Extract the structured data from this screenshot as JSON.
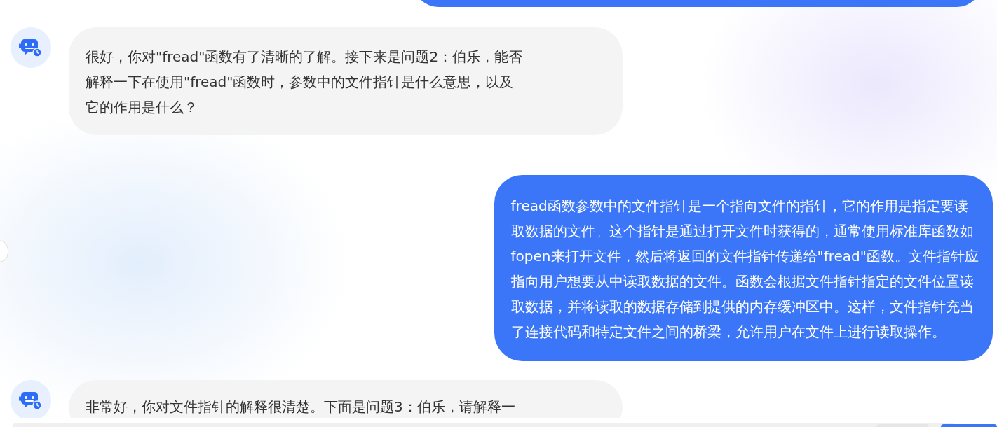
{
  "messages": [
    {
      "kind": "partial"
    },
    {
      "kind": "bot",
      "lines": [
        "很好，你对\"fread\"函数有了清晰的了解。接下来是问题2：伯乐，能否",
        "解释一下在使用\"fread\"函数时，参数中的文件指针是什么意思，以及",
        "它的作用是什么？"
      ]
    },
    {
      "kind": "user",
      "lines": [
        "fread函数参数中的文件指针是一个指向文件的指针，它的作用是指定要读",
        "取数据的文件。这个指针是通过打开文件时获得的，通常使用标准库函数如",
        "fopen来打开文件，然后将返回的文件指针传递给\"fread\"函数。文件指针应",
        "指向用户想要从中读取数据的文件。函数会根据文件指针指定的文件位置读",
        "取数据，并将读取的数据存储到提供的内存缓冲区中。这样，文件指针充当",
        "了连接代码和特定文件之间的桥梁，允许用户在文件上进行读取操作。"
      ]
    },
    {
      "kind": "bot",
      "lines": [
        "非常好，你对文件指针的解释很清楚。下面是问题3：伯乐，请解释一"
      ]
    }
  ]
}
